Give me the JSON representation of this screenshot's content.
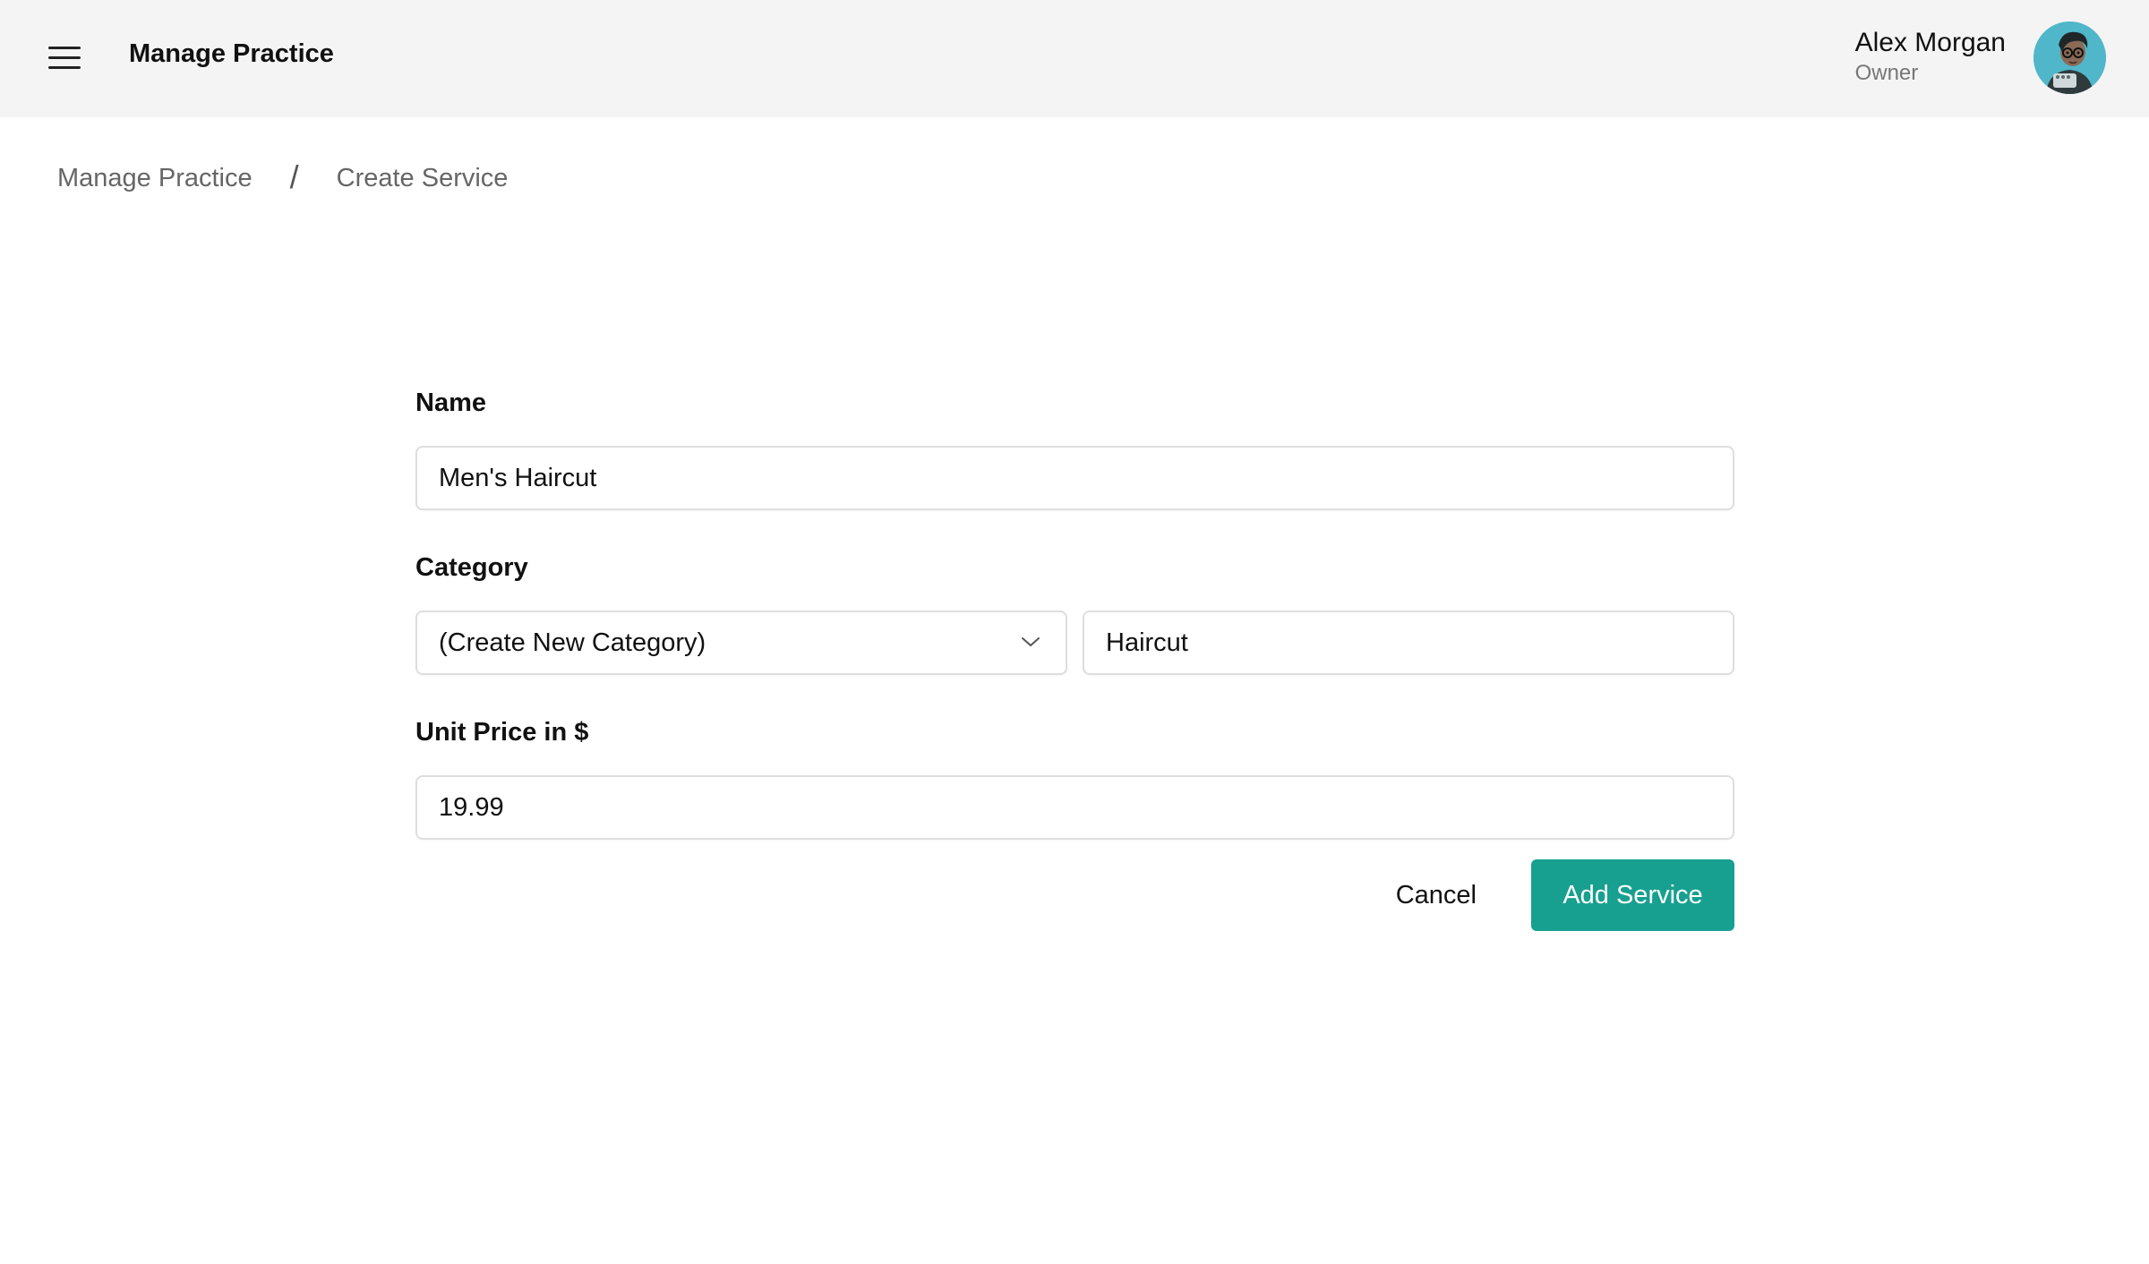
{
  "header": {
    "title": "Manage Practice",
    "user_name": "Alex Morgan",
    "user_role": "Owner"
  },
  "breadcrumb": {
    "items": [
      "Manage Practice",
      "Create Service"
    ],
    "separator": "/"
  },
  "form": {
    "name_label": "Name",
    "name_value": "Men's Haircut",
    "category_label": "Category",
    "category_select_value": "(Create New Category)",
    "category_new_value": "Haircut",
    "price_label": "Unit Price in $",
    "price_value": "19.99"
  },
  "actions": {
    "cancel_label": "Cancel",
    "add_label": "Add Service"
  },
  "colors": {
    "header_bg": "#f4f4f4",
    "accent": "#17a08f",
    "avatar_bg": "#4fb7c9"
  }
}
